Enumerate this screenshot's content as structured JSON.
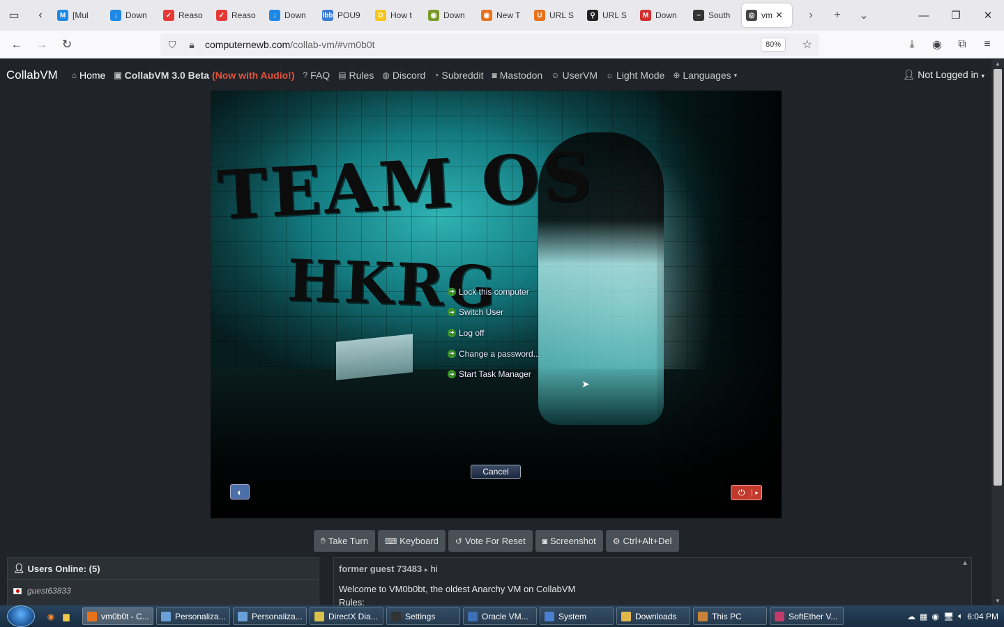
{
  "browser": {
    "tabs": [
      {
        "label": "[Mul",
        "color": "#1e88e5",
        "glyph": "M"
      },
      {
        "label": "Down",
        "color": "#1e88e5",
        "glyph": "↓"
      },
      {
        "label": "Reaso",
        "color": "#e53935",
        "glyph": "✓"
      },
      {
        "label": "Reaso",
        "color": "#e53935",
        "glyph": "✓"
      },
      {
        "label": "Down",
        "color": "#1e88e5",
        "glyph": "↓"
      },
      {
        "label": "POU9",
        "color": "#3a7bd5",
        "glyph": "lbb"
      },
      {
        "label": "How t",
        "color": "#f5c518",
        "glyph": "D"
      },
      {
        "label": "Down",
        "color": "#7a9a2a",
        "glyph": "◉"
      },
      {
        "label": "New T",
        "color": "#e8721c",
        "glyph": "◉"
      },
      {
        "label": "URL S",
        "color": "#e8721c",
        "glyph": "U"
      },
      {
        "label": "URL S",
        "color": "#222222",
        "glyph": "⚲"
      },
      {
        "label": "Down",
        "color": "#d32f2f",
        "glyph": "M"
      },
      {
        "label": "South",
        "color": "#333333",
        "glyph": "~"
      }
    ],
    "active_tab": {
      "label": "vm"
    },
    "url_host": "computernewb.com",
    "url_path": "/collab-vm/#vm0b0t",
    "zoom": "80%"
  },
  "site": {
    "brand": "CollabVM",
    "nav": {
      "home": "Home",
      "collab": "CollabVM 3.0 Beta",
      "audio": "(Now with Audio!)",
      "faq": "FAQ",
      "rules": "Rules",
      "discord": "Discord",
      "subreddit": "Subreddit",
      "mastodon": "Mastodon",
      "uservm": "UserVM",
      "lightmode": "Light Mode",
      "languages": "Languages"
    },
    "login": "Not Logged in"
  },
  "vm": {
    "wallpaper_text_1": "TEAM OS",
    "wallpaper_text_2": "HKRG",
    "security_options": [
      "Lock this computer",
      "Switch User",
      "Log off",
      "Change a password...",
      "Start Task Manager"
    ],
    "cancel": "Cancel"
  },
  "controls": {
    "take_turn": "Take Turn",
    "keyboard": "Keyboard",
    "vote_reset": "Vote For Reset",
    "screenshot": "Screenshot",
    "ctrl_alt_del": "Ctrl+Alt+Del"
  },
  "users": {
    "header": "Users Online: (5)",
    "list": [
      "guest63833"
    ]
  },
  "chat": {
    "messages": [
      {
        "user": "former guest 73483",
        "sep": "▸",
        "text": "hi"
      }
    ],
    "welcome": "Welcome to VM0b0bt, the oldest Anarchy VM on CollabVM",
    "rules_label": "Rules:"
  },
  "taskbar": {
    "tasks": [
      {
        "label": "vm0b0t - C...",
        "color": "#e8721c"
      },
      {
        "label": "Personaliza...",
        "color": "#6aa0d8"
      },
      {
        "label": "Personaliza...",
        "color": "#6aa0d8"
      },
      {
        "label": "DirectX Dia...",
        "color": "#d8c24a"
      },
      {
        "label": "Settings",
        "color": "#333333"
      },
      {
        "label": "Oracle VM...",
        "color": "#3d6fb5"
      },
      {
        "label": "System",
        "color": "#4a7fcf"
      },
      {
        "label": "Downloads",
        "color": "#e3b84a"
      },
      {
        "label": "This PC",
        "color": "#c8823a"
      },
      {
        "label": "SoftEther V...",
        "color": "#c23b6a"
      }
    ],
    "clock": "6:04 PM"
  }
}
